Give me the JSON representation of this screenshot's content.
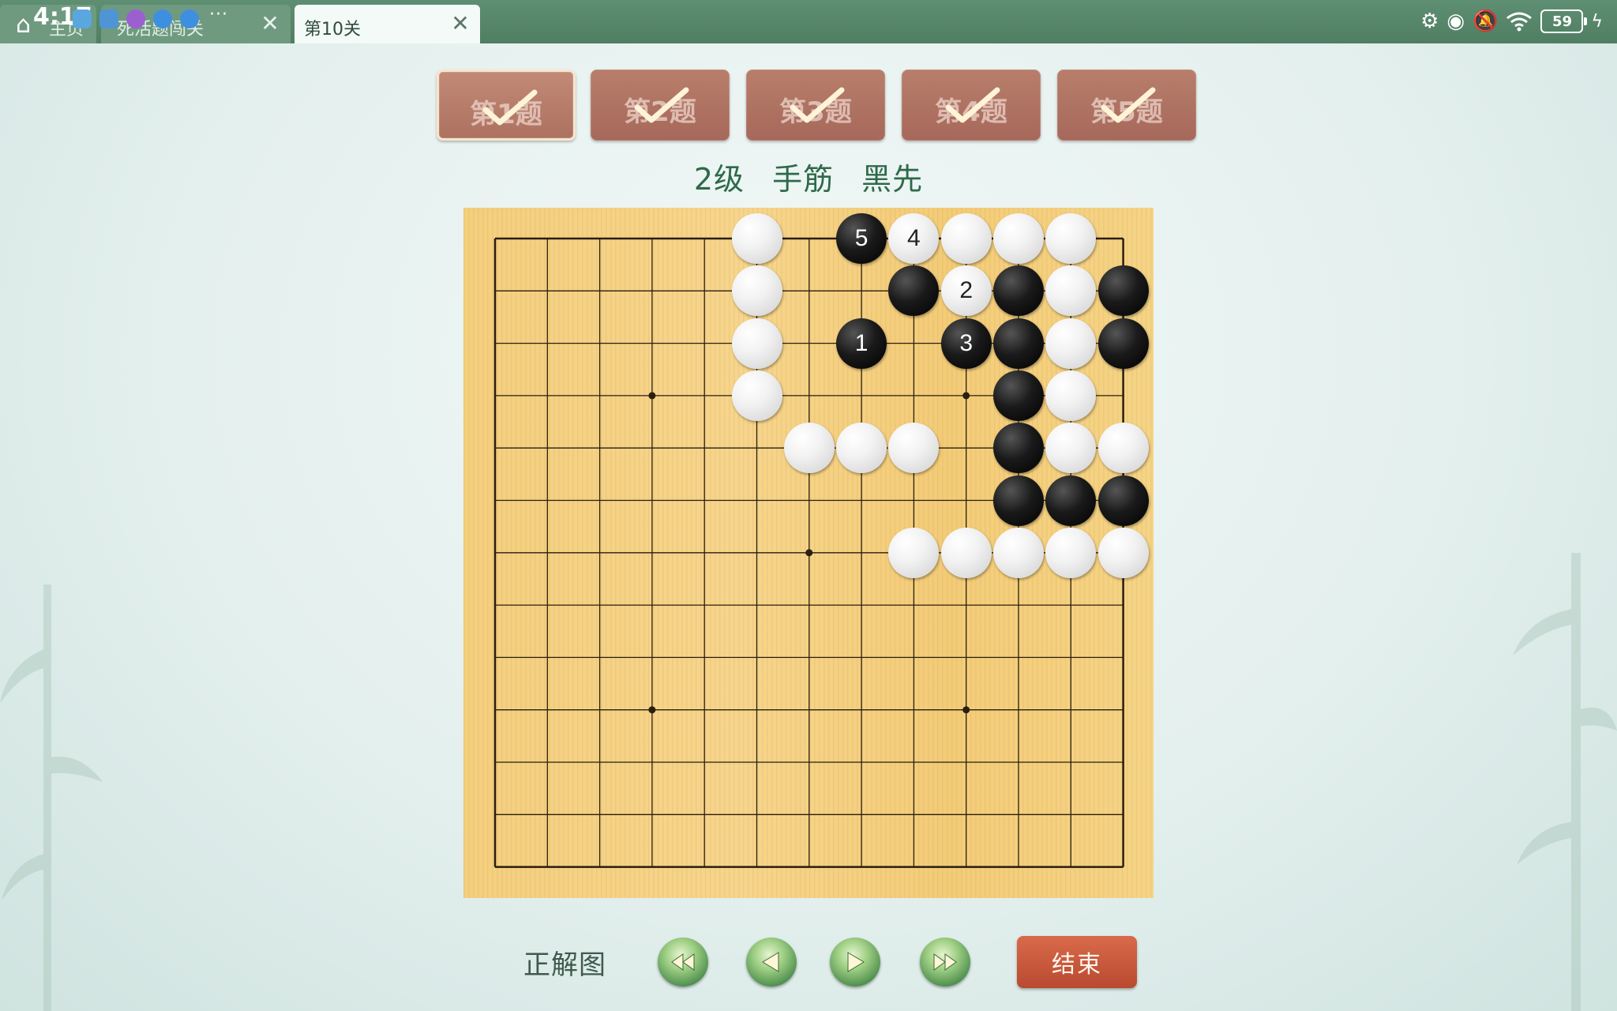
{
  "status_bar": {
    "time": "4:17",
    "battery": "59"
  },
  "tabs": [
    {
      "label": "主页",
      "active": false,
      "has_close": false
    },
    {
      "label": "死活题闯关",
      "active": false,
      "has_close": true
    },
    {
      "label": "第10关",
      "active": true,
      "has_close": true
    }
  ],
  "questions": [
    {
      "label": "第1题",
      "solved": true,
      "current": true
    },
    {
      "label": "第2题",
      "solved": true,
      "current": false
    },
    {
      "label": "第3题",
      "solved": true,
      "current": false
    },
    {
      "label": "第4题",
      "solved": true,
      "current": false
    },
    {
      "label": "第5题",
      "solved": true,
      "current": false
    }
  ],
  "subtitle": "2级 手筋 黑先",
  "board": {
    "size": 13,
    "star_points": [
      [
        3,
        3
      ],
      [
        9,
        3
      ],
      [
        6,
        6
      ],
      [
        3,
        9
      ],
      [
        9,
        9
      ]
    ],
    "stones": [
      {
        "col": 5,
        "row": 0,
        "color": "w"
      },
      {
        "col": 7,
        "row": 0,
        "color": "b",
        "label": "5"
      },
      {
        "col": 8,
        "row": 0,
        "color": "w",
        "label": "4"
      },
      {
        "col": 9,
        "row": 0,
        "color": "w"
      },
      {
        "col": 10,
        "row": 0,
        "color": "w"
      },
      {
        "col": 11,
        "row": 0,
        "color": "w"
      },
      {
        "col": 5,
        "row": 1,
        "color": "w"
      },
      {
        "col": 8,
        "row": 1,
        "color": "b"
      },
      {
        "col": 9,
        "row": 1,
        "color": "w",
        "label": "2"
      },
      {
        "col": 10,
        "row": 1,
        "color": "b"
      },
      {
        "col": 11,
        "row": 1,
        "color": "w"
      },
      {
        "col": 12,
        "row": 1,
        "color": "b"
      },
      {
        "col": 5,
        "row": 2,
        "color": "w"
      },
      {
        "col": 7,
        "row": 2,
        "color": "b",
        "label": "1"
      },
      {
        "col": 9,
        "row": 2,
        "color": "b",
        "label": "3"
      },
      {
        "col": 10,
        "row": 2,
        "color": "b"
      },
      {
        "col": 11,
        "row": 2,
        "color": "w"
      },
      {
        "col": 12,
        "row": 2,
        "color": "b"
      },
      {
        "col": 5,
        "row": 3,
        "color": "w"
      },
      {
        "col": 10,
        "row": 3,
        "color": "b"
      },
      {
        "col": 11,
        "row": 3,
        "color": "w"
      },
      {
        "col": 6,
        "row": 4,
        "color": "w"
      },
      {
        "col": 7,
        "row": 4,
        "color": "w"
      },
      {
        "col": 8,
        "row": 4,
        "color": "w"
      },
      {
        "col": 10,
        "row": 4,
        "color": "b"
      },
      {
        "col": 11,
        "row": 4,
        "color": "w"
      },
      {
        "col": 12,
        "row": 4,
        "color": "w"
      },
      {
        "col": 10,
        "row": 5,
        "color": "b"
      },
      {
        "col": 11,
        "row": 5,
        "color": "b"
      },
      {
        "col": 12,
        "row": 5,
        "color": "b"
      },
      {
        "col": 8,
        "row": 6,
        "color": "w"
      },
      {
        "col": 9,
        "row": 6,
        "color": "w"
      },
      {
        "col": 10,
        "row": 6,
        "color": "w"
      },
      {
        "col": 11,
        "row": 6,
        "color": "w"
      },
      {
        "col": 12,
        "row": 6,
        "color": "w"
      }
    ]
  },
  "controls": {
    "solution_label": "正解图",
    "buttons": [
      "first-icon",
      "prev-icon",
      "next-icon",
      "last-icon"
    ],
    "end_label": "结束"
  },
  "colors": {
    "topbar": "#4f7e63",
    "question_button": "#a6685a",
    "subtitle": "#2e6a4a",
    "board": "#f4cf7e",
    "end_button": "#c9573a"
  }
}
